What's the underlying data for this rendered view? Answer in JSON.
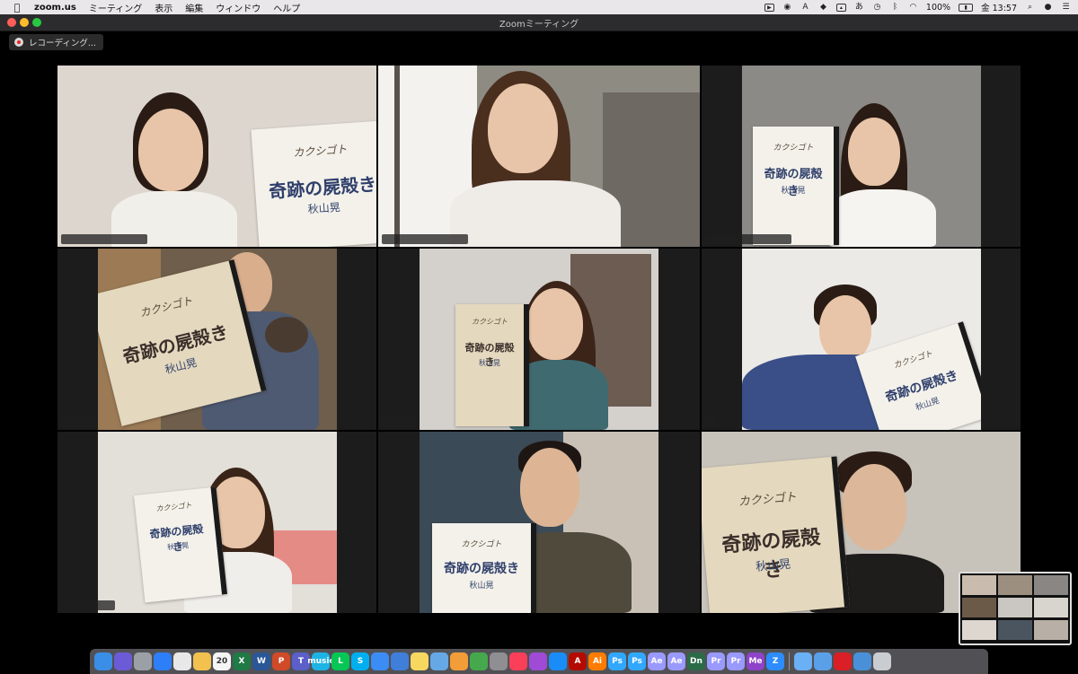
{
  "menubar": {
    "apple": "",
    "app_name": "zoom.us",
    "menus": [
      "ミーティング",
      "表示",
      "編集",
      "ウィンドウ",
      "ヘルプ"
    ],
    "battery": "100%",
    "clock": "金 13:57",
    "input_method": "あ"
  },
  "window": {
    "title": "Zoomミーティング"
  },
  "recording": {
    "label": "レコーディング..."
  },
  "script_book": {
    "logo": "カクシゴト",
    "title": "奇跡の屍殻き",
    "subtitle": "秋山晃"
  },
  "participants_count": 9,
  "active_speaker_index": 1,
  "dock": {
    "items": [
      "finder-icon",
      "siri-icon",
      "launchpad-icon",
      "safari-icon",
      "chrome-icon",
      "photos-icon",
      "calendar-icon",
      "excel-icon",
      "word-icon",
      "powerpoint-icon",
      "teams-icon",
      "amazon-music-icon",
      "line-icon",
      "skype-icon",
      "messenger-icon",
      "keynote-icon",
      "notes-icon",
      "preview-icon",
      "pages-icon",
      "numbers-icon",
      "system-preferences-icon",
      "music-icon",
      "podcasts-icon",
      "app-store-icon",
      "acrobat-icon",
      "illustrator-icon",
      "photoshop-icon",
      "photoshop-icon-2",
      "after-effects-icon",
      "after-effects-icon-2",
      "dimension-icon",
      "premiere-icon",
      "premiere-icon-2",
      "media-encoder-icon",
      "zoom-icon",
      "folder-icon",
      "folder-icon-2",
      "creative-cloud-icon",
      "folder-icon-3",
      "trash-icon"
    ],
    "labels": [
      "",
      "",
      "",
      "",
      "",
      "",
      "20",
      "X",
      "W",
      "P",
      "T",
      "music",
      "L",
      "S",
      "",
      "",
      "",
      "",
      "",
      "",
      "",
      "",
      "",
      "",
      "A",
      "Ai",
      "Ps",
      "Ps",
      "Ae",
      "Ae",
      "Dn",
      "Pr",
      "Pr",
      "Me",
      "Z",
      "",
      "",
      "",
      "",
      ""
    ]
  }
}
